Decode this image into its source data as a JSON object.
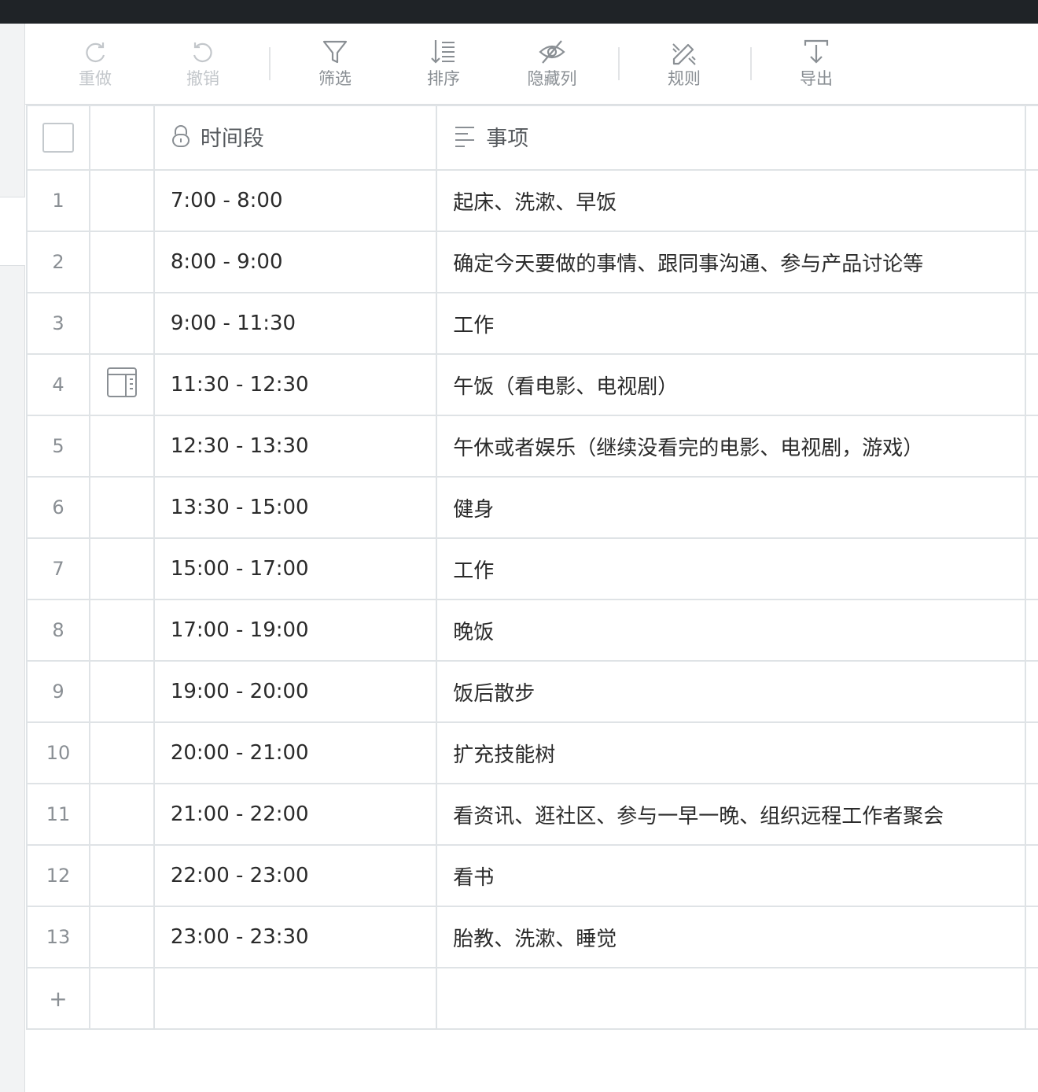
{
  "toolbar": {
    "redo": "重做",
    "undo": "撤销",
    "filter": "筛选",
    "sort": "排序",
    "hide_columns": "隐藏列",
    "rules": "规则",
    "export": "导出"
  },
  "table": {
    "columns": {
      "time": "时间段",
      "item": "事项"
    },
    "rows": [
      {
        "num": "1",
        "time": "7:00 - 8:00",
        "item": "起床、洗漱、早饭"
      },
      {
        "num": "2",
        "time": "8:00 - 9:00",
        "item": "确定今天要做的事情、跟同事沟通、参与产品讨论等"
      },
      {
        "num": "3",
        "time": "9:00 - 11:30",
        "item": "工作"
      },
      {
        "num": "4",
        "time": "11:30 - 12:30",
        "item": "午饭（看电影、电视剧）"
      },
      {
        "num": "5",
        "time": "12:30 - 13:30",
        "item": "午休或者娱乐（继续没看完的电影、电视剧，游戏）"
      },
      {
        "num": "6",
        "time": "13:30 - 15:00",
        "item": "健身"
      },
      {
        "num": "7",
        "time": "15:00 - 17:00",
        "item": "工作"
      },
      {
        "num": "8",
        "time": "17:00 - 19:00",
        "item": "晚饭"
      },
      {
        "num": "9",
        "time": "19:00 - 20:00",
        "item": "饭后散步"
      },
      {
        "num": "10",
        "time": "20:00 - 21:00",
        "item": "扩充技能树"
      },
      {
        "num": "11",
        "time": "21:00 - 22:00",
        "item": "看资讯、逛社区、参与一早一晚、组织远程工作者聚会"
      },
      {
        "num": "12",
        "time": "22:00 - 23:00",
        "item": "看书"
      },
      {
        "num": "13",
        "time": "23:00 - 23:30",
        "item": "胎教、洗漱、睡觉"
      }
    ],
    "add_row": "+"
  },
  "icons": {
    "redo": "redo-icon",
    "undo": "undo-icon",
    "filter": "filter-icon",
    "sort": "sort-icon",
    "hide": "eye-off-icon",
    "rules": "rules-icon",
    "export": "export-icon",
    "lock": "lock-icon",
    "text": "text-column-icon",
    "expand": "expand-row-icon"
  },
  "colors": {
    "accent": "#4a9a5a",
    "column_divider": "#8fae98"
  }
}
